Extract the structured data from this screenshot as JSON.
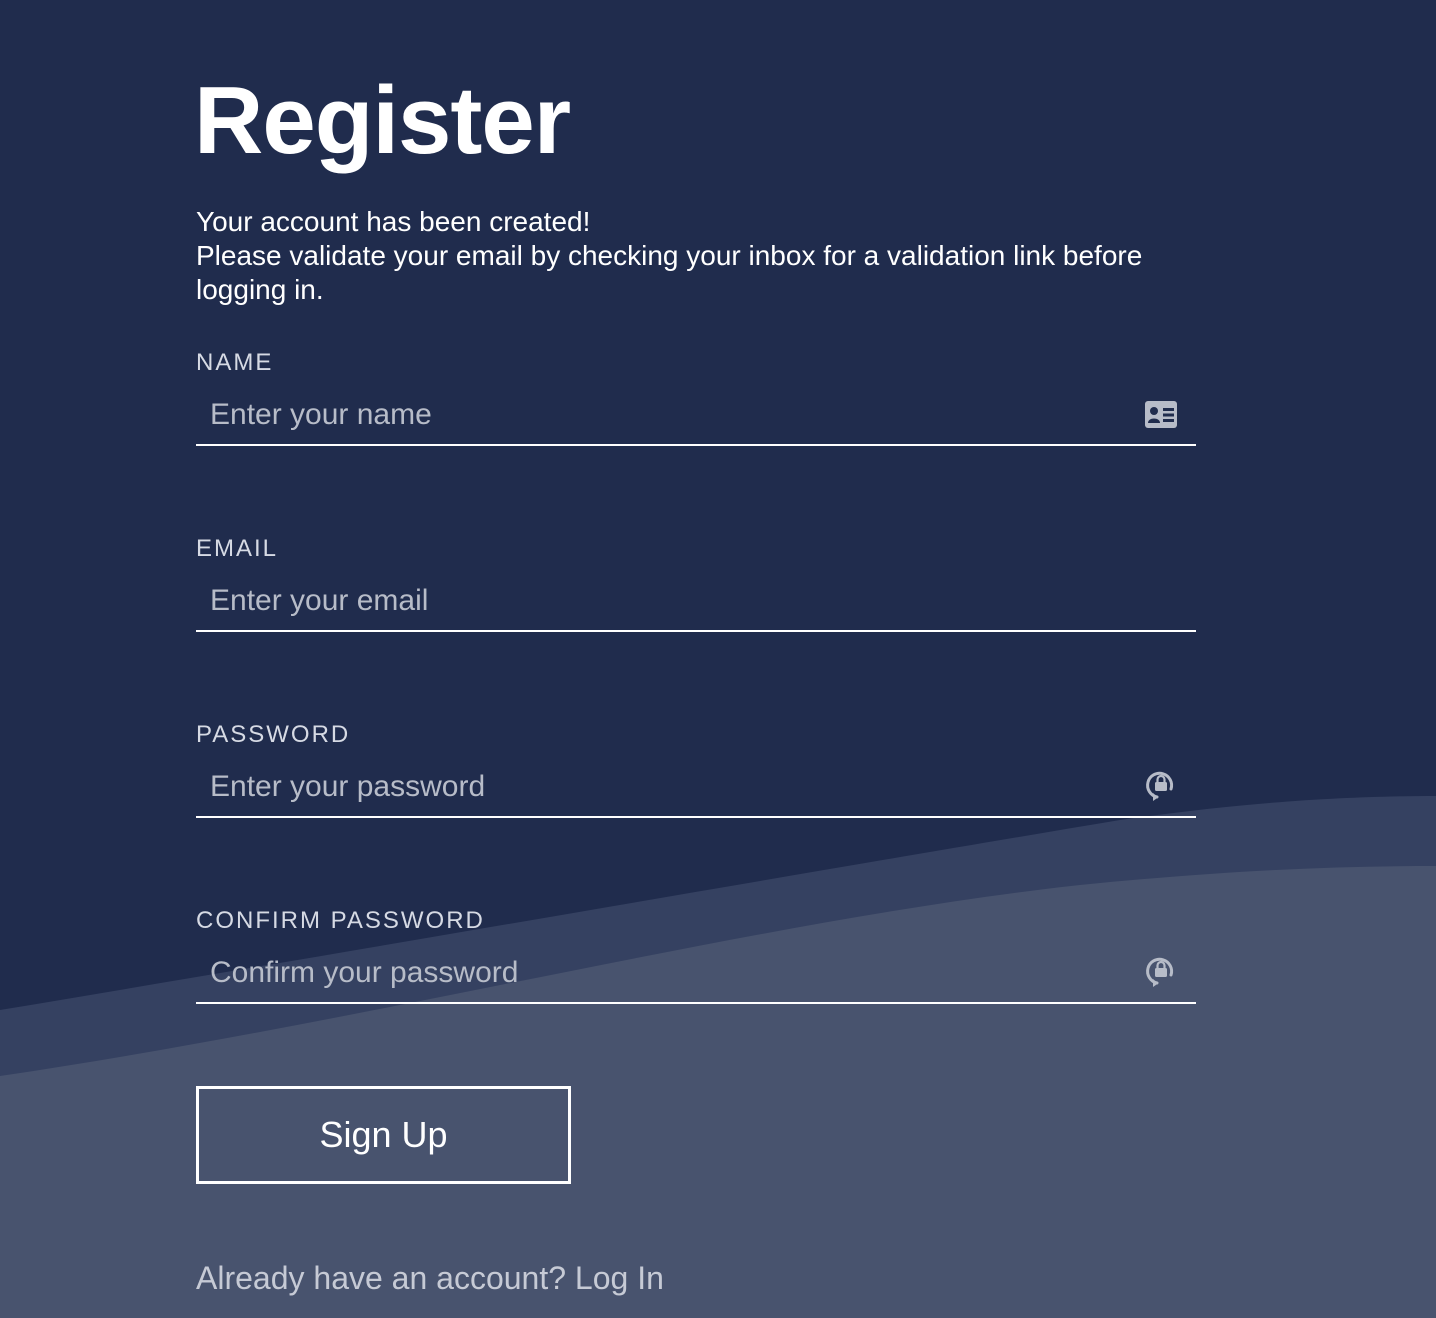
{
  "page": {
    "title": "Register",
    "message_line1": "Your account has been created!",
    "message_line2": "Please validate your email by checking your inbox for a validation link before logging in."
  },
  "form": {
    "name": {
      "label": "NAME",
      "placeholder": "Enter your name",
      "value": "",
      "icon": "id-card-icon"
    },
    "email": {
      "label": "EMAIL",
      "placeholder": "Enter your email",
      "value": ""
    },
    "password": {
      "label": "PASSWORD",
      "placeholder": "Enter your password",
      "value": "",
      "icon": "lock-rotate-icon"
    },
    "confirm_password": {
      "label": "CONFIRM PASSWORD",
      "placeholder": "Confirm your password",
      "value": "",
      "icon": "lock-rotate-icon"
    },
    "submit_label": "Sign Up"
  },
  "footer": {
    "prompt": "Already have an account?",
    "login_link": "Log In"
  },
  "colors": {
    "background": "#202c4d",
    "wave_mid": "#354161",
    "wave_light": "#48536e",
    "text": "#ffffff",
    "muted_text": "#c6cad5",
    "icon": "#b7bcc8"
  }
}
